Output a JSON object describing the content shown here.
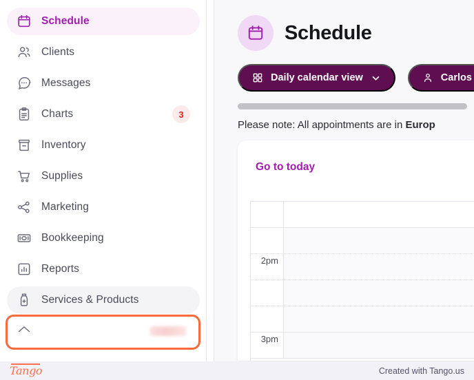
{
  "sidebar": {
    "items": [
      {
        "label": "Schedule",
        "icon": "calendar-icon",
        "state": "active"
      },
      {
        "label": "Clients",
        "icon": "users-icon",
        "state": "normal"
      },
      {
        "label": "Messages",
        "icon": "chat-bubble-icon",
        "state": "normal"
      },
      {
        "label": "Charts",
        "icon": "clipboard-icon",
        "state": "normal",
        "badge": "3"
      },
      {
        "label": "Inventory",
        "icon": "archive-box-icon",
        "state": "normal"
      },
      {
        "label": "Supplies",
        "icon": "shopping-cart-icon",
        "state": "normal"
      },
      {
        "label": "Marketing",
        "icon": "share-nodes-icon",
        "state": "normal"
      },
      {
        "label": "Bookkeeping",
        "icon": "banknote-icon",
        "state": "normal"
      },
      {
        "label": "Reports",
        "icon": "bar-chart-icon",
        "state": "normal"
      },
      {
        "label": "Services & Products",
        "icon": "product-bottle-icon",
        "state": "highlighted"
      },
      {
        "label": "",
        "icon": "help-icon",
        "state": "cut-off",
        "badge": ""
      }
    ]
  },
  "header": {
    "title": "Schedule",
    "icon": "calendar-icon"
  },
  "toolbar": {
    "view_button": {
      "label": "Daily calendar view",
      "icon": "grid-icon",
      "chevron": "chevron-down-icon"
    },
    "provider_button": {
      "label": "Carlos Provid",
      "icon": "person-icon"
    }
  },
  "note": {
    "prefix": "Please note: All appointments are in ",
    "emphasis": "Europ"
  },
  "calendar": {
    "go_to_today": "Go to today",
    "rows": [
      {
        "time": "",
        "shade": "white"
      },
      {
        "time": "",
        "shade": "shaded"
      },
      {
        "time": "2pm",
        "shade": "shaded"
      },
      {
        "time": "",
        "shade": "shaded"
      },
      {
        "time": "",
        "shade": "shaded"
      },
      {
        "time": "3pm",
        "shade": "shaded"
      }
    ]
  },
  "footer": {
    "logo": "Tango",
    "credit": "Created with Tango.us"
  },
  "colors": {
    "accent_purple": "#a21caf",
    "pill_purple": "#5f0f51",
    "highlight_orange": "#f96b3c",
    "badge_red": "#d92d20"
  }
}
